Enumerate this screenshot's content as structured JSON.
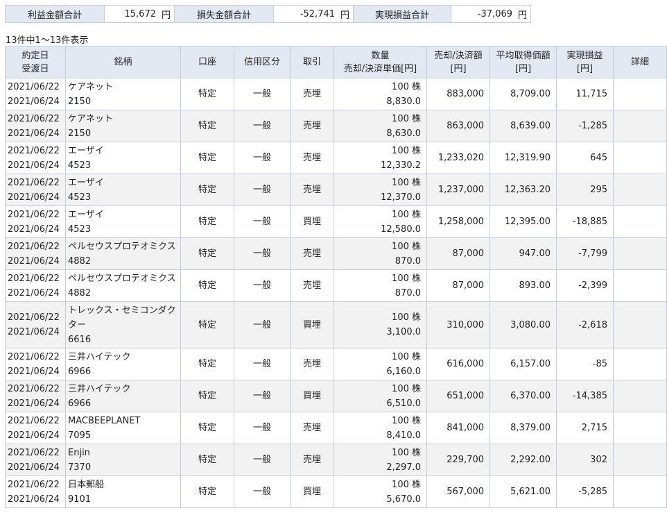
{
  "summary": {
    "profit_label": "利益金額合計",
    "profit_value": "15,672",
    "profit_unit": "円",
    "loss_label": "損失金額合計",
    "loss_value": "-52,741",
    "loss_unit": "円",
    "realized_label": "実現損益合計",
    "realized_value": "-37,069",
    "realized_unit": "円"
  },
  "count_text": "13件中1～13件表示",
  "headers": {
    "date1": "約定日",
    "date2": "受渡日",
    "name": "銘柄",
    "account": "口座",
    "credit": "信用区分",
    "trade": "取引",
    "qty1": "数量",
    "qty2": "売却/決済単価[円]",
    "sale1": "売却/決済額",
    "sale2": "[円]",
    "avg1": "平均取得価額",
    "avg2": "[円]",
    "pl1": "実現損益",
    "pl2": "[円]",
    "detail": "詳細"
  },
  "rows": [
    {
      "trade_date": "2021/06/22",
      "settle_date": "2021/06/24",
      "name": "ケアネット",
      "code": "2150",
      "account": "特定",
      "credit": "一般",
      "trade": "売埋",
      "qty": "100 株",
      "price": "8,830.0",
      "amount": "883,000",
      "avg": "8,709.00",
      "pl": "11,715"
    },
    {
      "trade_date": "2021/06/22",
      "settle_date": "2021/06/24",
      "name": "ケアネット",
      "code": "2150",
      "account": "特定",
      "credit": "一般",
      "trade": "売埋",
      "qty": "100 株",
      "price": "8,630.0",
      "amount": "863,000",
      "avg": "8,639.00",
      "pl": "-1,285"
    },
    {
      "trade_date": "2021/06/22",
      "settle_date": "2021/06/24",
      "name": "エーザイ",
      "code": "4523",
      "account": "特定",
      "credit": "一般",
      "trade": "売埋",
      "qty": "100 株",
      "price": "12,330.2",
      "amount": "1,233,020",
      "avg": "12,319.90",
      "pl": "645"
    },
    {
      "trade_date": "2021/06/22",
      "settle_date": "2021/06/24",
      "name": "エーザイ",
      "code": "4523",
      "account": "特定",
      "credit": "一般",
      "trade": "売埋",
      "qty": "100 株",
      "price": "12,370.0",
      "amount": "1,237,000",
      "avg": "12,363.20",
      "pl": "295"
    },
    {
      "trade_date": "2021/06/22",
      "settle_date": "2021/06/24",
      "name": "エーザイ",
      "code": "4523",
      "account": "特定",
      "credit": "一般",
      "trade": "買埋",
      "qty": "100 株",
      "price": "12,580.0",
      "amount": "1,258,000",
      "avg": "12,395.00",
      "pl": "-18,885"
    },
    {
      "trade_date": "2021/06/22",
      "settle_date": "2021/06/24",
      "name": "ペルセウスプロテオミクス",
      "code": "4882",
      "account": "特定",
      "credit": "一般",
      "trade": "売埋",
      "qty": "100 株",
      "price": "870.0",
      "amount": "87,000",
      "avg": "947.00",
      "pl": "-7,799"
    },
    {
      "trade_date": "2021/06/22",
      "settle_date": "2021/06/24",
      "name": "ペルセウスプロテオミクス",
      "code": "4882",
      "account": "特定",
      "credit": "一般",
      "trade": "売埋",
      "qty": "100 株",
      "price": "870.0",
      "amount": "87,000",
      "avg": "893.00",
      "pl": "-2,399"
    },
    {
      "trade_date": "2021/06/22",
      "settle_date": "2021/06/24",
      "name": "トレックス・セミコンダクター",
      "code": "6616",
      "account": "特定",
      "credit": "一般",
      "trade": "買埋",
      "qty": "100 株",
      "price": "3,100.0",
      "amount": "310,000",
      "avg": "3,080.00",
      "pl": "-2,618"
    },
    {
      "trade_date": "2021/06/22",
      "settle_date": "2021/06/24",
      "name": "三井ハイテック",
      "code": "6966",
      "account": "特定",
      "credit": "一般",
      "trade": "売埋",
      "qty": "100 株",
      "price": "6,160.0",
      "amount": "616,000",
      "avg": "6,157.00",
      "pl": "-85"
    },
    {
      "trade_date": "2021/06/22",
      "settle_date": "2021/06/24",
      "name": "三井ハイテック",
      "code": "6966",
      "account": "特定",
      "credit": "一般",
      "trade": "買埋",
      "qty": "100 株",
      "price": "6,510.0",
      "amount": "651,000",
      "avg": "6,370.00",
      "pl": "-14,385"
    },
    {
      "trade_date": "2021/06/22",
      "settle_date": "2021/06/24",
      "name": "MACBEEPLANET",
      "code": "7095",
      "account": "特定",
      "credit": "一般",
      "trade": "売埋",
      "qty": "100 株",
      "price": "8,410.0",
      "amount": "841,000",
      "avg": "8,379.00",
      "pl": "2,715"
    },
    {
      "trade_date": "2021/06/22",
      "settle_date": "2021/06/24",
      "name": "Enjin",
      "code": "7370",
      "account": "特定",
      "credit": "一般",
      "trade": "売埋",
      "qty": "100 株",
      "price": "2,297.0",
      "amount": "229,700",
      "avg": "2,292.00",
      "pl": "302"
    },
    {
      "trade_date": "2021/06/22",
      "settle_date": "2021/06/24",
      "name": "日本郵船",
      "code": "9101",
      "account": "特定",
      "credit": "一般",
      "trade": "買埋",
      "qty": "100 株",
      "price": "5,670.0",
      "amount": "567,000",
      "avg": "5,621.00",
      "pl": "-5,285"
    }
  ]
}
